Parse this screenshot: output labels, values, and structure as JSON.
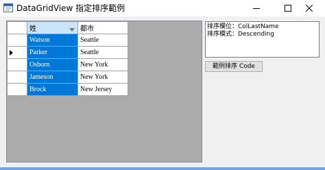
{
  "window": {
    "title": "DataGridView 指定排序範例",
    "icons": {
      "app": "form-icon",
      "minimize": "minimize-icon",
      "maximize": "maximize-icon",
      "close": "close-icon"
    }
  },
  "grid": {
    "columns": [
      {
        "label": "姓",
        "sorted": "descending"
      },
      {
        "label": "都市"
      }
    ],
    "current_row": 1,
    "rows": [
      {
        "last_name": "Watson",
        "city": "Seattle"
      },
      {
        "last_name": "Parker",
        "city": "Seattle"
      },
      {
        "last_name": "Osborn",
        "city": "New York"
      },
      {
        "last_name": "Jameson",
        "city": "New York"
      },
      {
        "last_name": "Brock",
        "city": "New Jersey"
      }
    ],
    "colors": {
      "selection": "#0078d7",
      "sorted_header": "#cce4f7",
      "background": "#ababab"
    }
  },
  "info": {
    "text": "排序欄位：ColLastName\n排序模式：Descending"
  },
  "code_button": {
    "label": "範例排序 Code"
  }
}
